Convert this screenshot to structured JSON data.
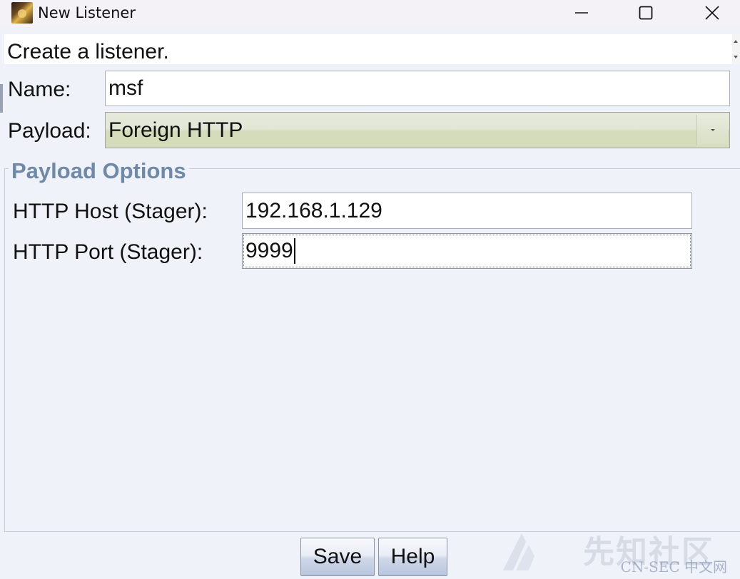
{
  "window": {
    "title": "New Listener",
    "controls": {
      "minimize": "minimize-icon",
      "maximize": "maximize-icon",
      "close": "close-icon"
    }
  },
  "header": {
    "text": "Create a listener."
  },
  "form": {
    "name_label": "Name:",
    "name_value": "msf",
    "payload_label": "Payload:",
    "payload_value": "Foreign HTTP"
  },
  "payload_options": {
    "title": "Payload Options",
    "host_label": "HTTP Host (Stager):",
    "host_value": "192.168.1.129",
    "port_label": "HTTP Port (Stager):",
    "port_value": "9999"
  },
  "buttons": {
    "save": "Save",
    "help": "Help"
  },
  "watermark": {
    "main": "先知社区",
    "sub": "CN-SEC 中文网"
  },
  "colors": {
    "group_title": "#6f8aa8",
    "combo_fill": "#d4dcbc",
    "window_bg": "#eff2f9"
  }
}
